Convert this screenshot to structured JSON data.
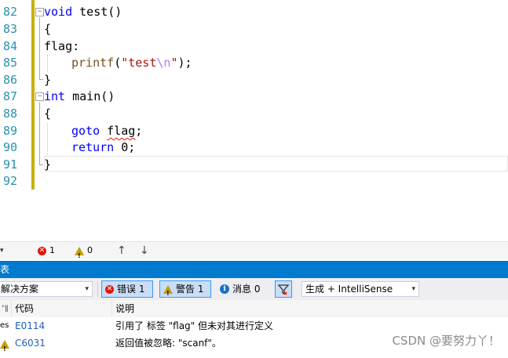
{
  "editor": {
    "line_numbers": [
      "82",
      "83",
      "84",
      "85",
      "86",
      "87",
      "88",
      "89",
      "90",
      "91",
      "92"
    ],
    "lines": {
      "l82_kw": "void",
      "l82_rest": " test()",
      "l83": "{",
      "l84": "flag:",
      "l85_fn": "printf",
      "l85_open": "(",
      "l85_str1": "\"test",
      "l85_esc": "\\n",
      "l85_str2": "\"",
      "l85_close": ");",
      "l86": "}",
      "l87_kw": "int",
      "l87_rest": " main()",
      "l88": "{",
      "l89_kw": "goto",
      "l89_label": "flag",
      "l89_semi": ";",
      "l90_kw": "return",
      "l90_rest": " 0;",
      "l91": "}"
    },
    "fold_glyph": "−",
    "colors": {
      "keyword": "#0000ff",
      "string": "#a31515",
      "escape": "#b776fb",
      "line_number": "#2b91af",
      "change_bar": "#c8b000"
    }
  },
  "status": {
    "error_count": "1",
    "warning_count": "0",
    "up_arrow": "↑",
    "down_arrow": "↓",
    "dropdown_caret": "▾"
  },
  "error_list": {
    "title": "表",
    "scope_dropdown": "解决方案",
    "errors_button": "错误 1",
    "warnings_button": "警告 1",
    "messages_button": "消息 0",
    "build_dropdown": "生成 + IntelliSense",
    "columns": {
      "code": "代码",
      "description": "说明"
    },
    "rows": [
      {
        "prefix": "es",
        "code": "E0114",
        "description": "引用了 标签 \"flag\" 但未对其进行定义"
      },
      {
        "prefix": "",
        "code": "C6031",
        "description": "返回值被忽略: \"scanf\"。"
      }
    ],
    "colors": {
      "title_bar": "#007acc",
      "error": "#e51400",
      "warning": "#c69c00",
      "info": "#1e6fc7"
    }
  },
  "watermark": "CSDN @要努力丫！"
}
